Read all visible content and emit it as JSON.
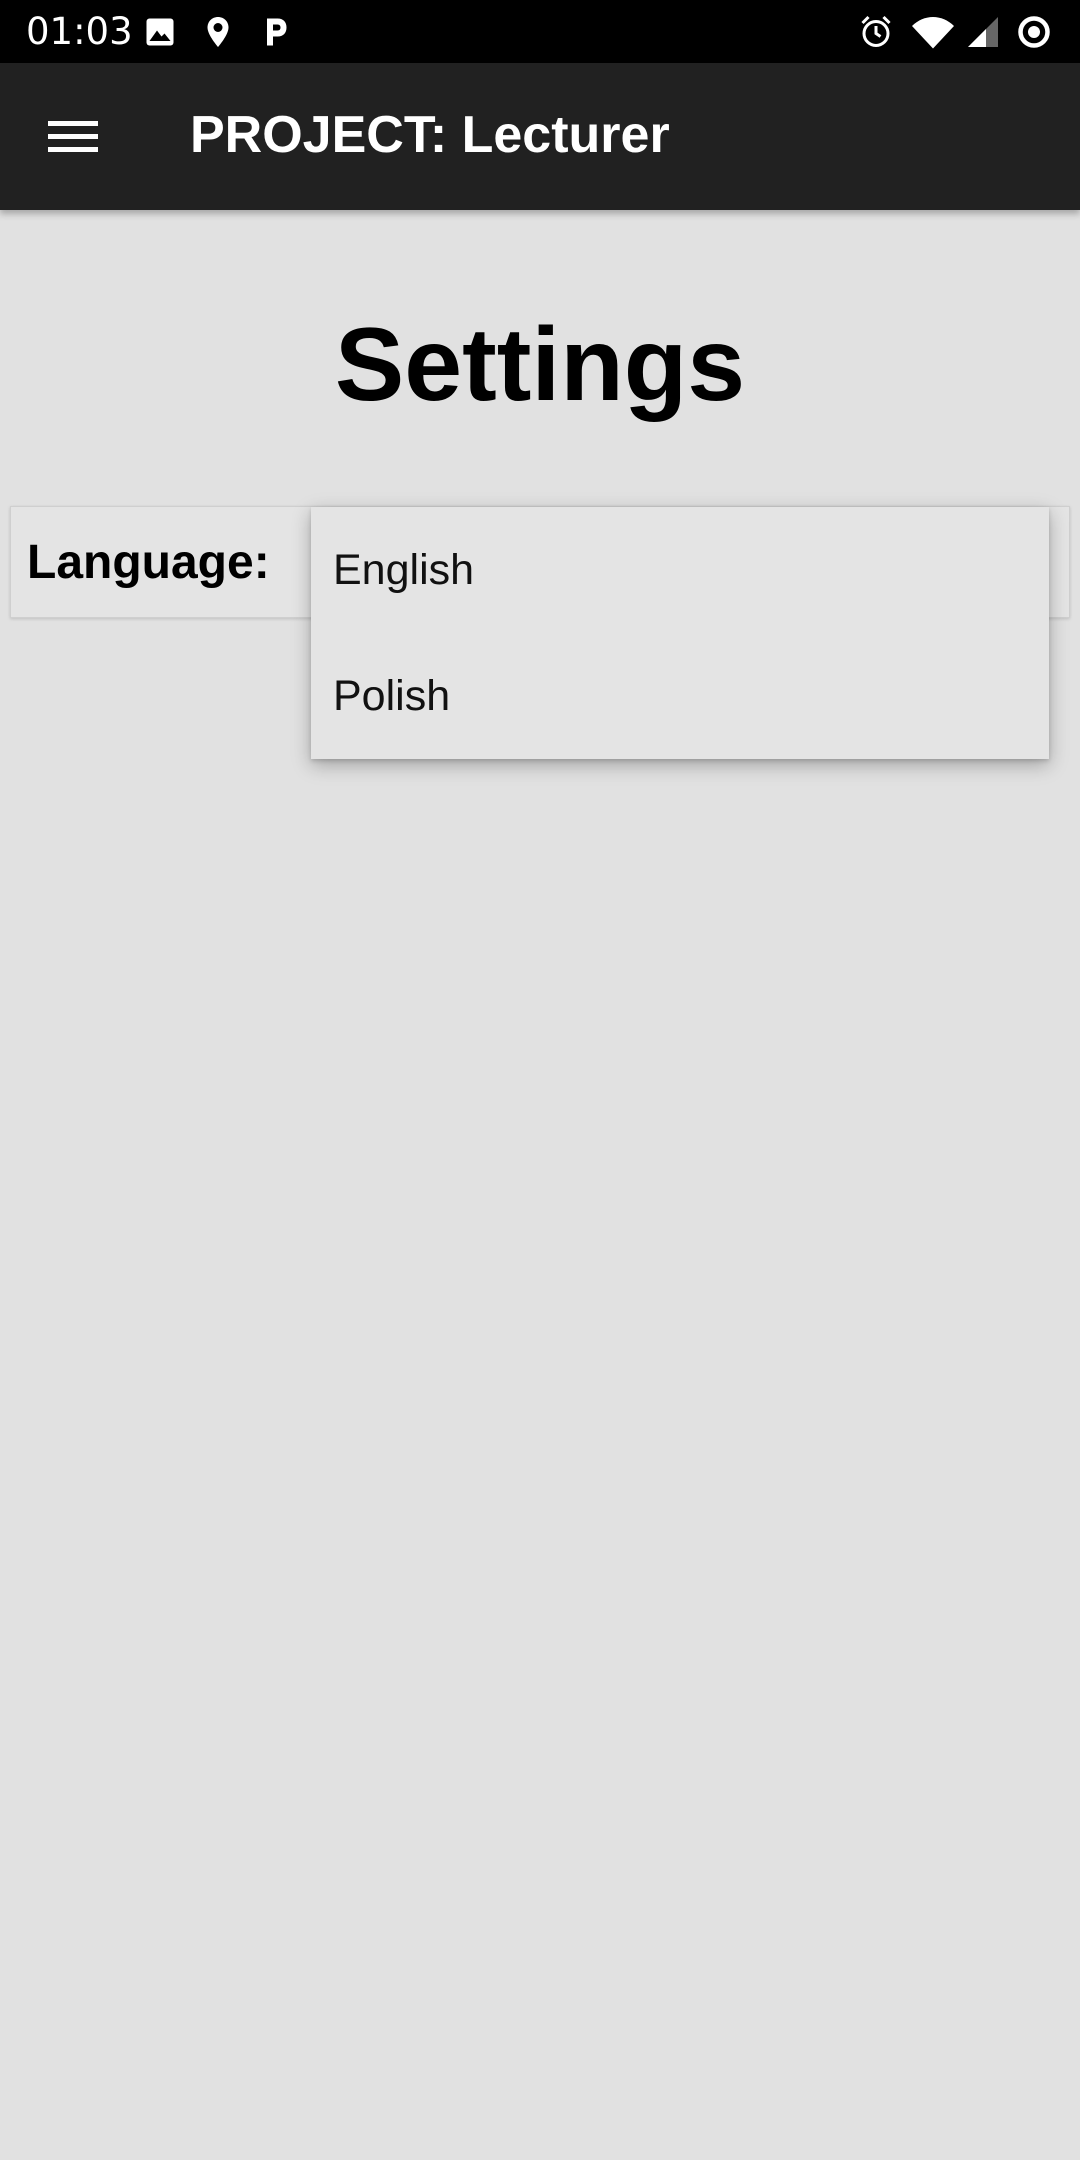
{
  "status_bar": {
    "time": "01:03",
    "left_icons": [
      "image-icon",
      "location-pin-icon",
      "parking-app-icon"
    ],
    "right_icons": [
      "alarm-icon",
      "wifi-icon",
      "cell-signal-icon",
      "record-icon"
    ]
  },
  "app_bar": {
    "title": "PROJECT: Lecturer",
    "menu_icon": "hamburger-menu-icon",
    "background": "#212121"
  },
  "page": {
    "title": "Settings",
    "background": "#e1e1e1"
  },
  "settings": {
    "language_label": "Language:"
  },
  "language_dropdown": {
    "options": [
      "English",
      "Polish"
    ]
  }
}
